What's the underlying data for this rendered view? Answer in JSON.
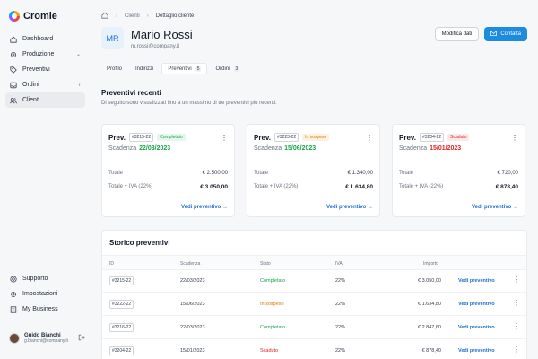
{
  "app": {
    "name": "Cromie"
  },
  "sidebar": {
    "items": [
      {
        "label": "Dashboard",
        "icon": "home-icon"
      },
      {
        "label": "Produzione",
        "icon": "gear-icon",
        "chevron": "⌄"
      },
      {
        "label": "Preventivi",
        "icon": "tag-icon"
      },
      {
        "label": "Ordini",
        "icon": "inbox-icon",
        "count": "7"
      },
      {
        "label": "Clienti",
        "icon": "users-icon",
        "active": true
      }
    ],
    "bottom": [
      {
        "label": "Supporto",
        "icon": "help-icon"
      },
      {
        "label": "Impostazioni",
        "icon": "settings-icon"
      },
      {
        "label": "My Business",
        "icon": "building-icon"
      }
    ],
    "user": {
      "name": "Guido Bianchi",
      "email": "g.bianchi@company.it"
    }
  },
  "breadcrumb": {
    "items": [
      "Clienti",
      "Dettaglio cliente"
    ]
  },
  "client": {
    "initials": "MR",
    "name": "Mario Rossi",
    "email": "m.rossi@company.it"
  },
  "header": {
    "edit_label": "Modifica dati",
    "contact_label": "Contatta"
  },
  "tabs": [
    {
      "label": "Profilo"
    },
    {
      "label": "Indirizzi"
    },
    {
      "label": "Preventivi",
      "count": "5",
      "active": true
    },
    {
      "label": "Ordini",
      "count": "3"
    }
  ],
  "recent": {
    "title": "Preventivi recenti",
    "subtitle": "Di seguito sono visualizzati fino a un massimo di tre preventivi più recenti.",
    "cards": [
      {
        "prefix": "Prev.",
        "code": "#3215-22",
        "status": "Completato",
        "due_label": "Scadenza",
        "due": "22/03/2023",
        "total_label": "Totale",
        "total": "€ 2.500,00",
        "total_iva_label": "Totale + IVA (22%)",
        "total_iva": "€ 3.050,00",
        "link": "Vedi preventivo →"
      },
      {
        "prefix": "Prev.",
        "code": "#3223-22",
        "status": "In sospeso",
        "due_label": "Scadenza",
        "due": "15/06/2023",
        "total_label": "Totale",
        "total": "€ 1.340,00",
        "total_iva_label": "Totale + IVA (22%)",
        "total_iva": "€ 1.634,80",
        "link": "Vedi preventivo →"
      },
      {
        "prefix": "Prev.",
        "code": "#3204-22",
        "status": "Scaduto",
        "due_label": "Scadenza",
        "due": "15/01/2023",
        "total_label": "Totale",
        "total": "€ 720,00",
        "total_iva_label": "Totale + IVA (22%)",
        "total_iva": "€ 878,40",
        "link": "Vedi preventivo →"
      }
    ]
  },
  "history": {
    "title": "Storico preventivi",
    "columns": [
      "ID",
      "Scadenza",
      "Stato",
      "IVA",
      "Importo"
    ],
    "rows": [
      {
        "id": "#3215-22",
        "due": "22/03/2023",
        "status": "Completato",
        "iva": "22%",
        "amount": "€ 3.050,00",
        "link": "Vedi preventivo"
      },
      {
        "id": "#3222-22",
        "due": "15/06/2023",
        "status": "In sospeso",
        "iva": "22%",
        "amount": "€ 1.634,80",
        "link": "Vedi preventivo"
      },
      {
        "id": "#3216-22",
        "due": "22/03/2023",
        "status": "Completato",
        "iva": "22%",
        "amount": "€ 2.847,60",
        "link": "Vedi preventivo"
      },
      {
        "id": "#3204-22",
        "due": "15/01/2023",
        "status": "Scaduto",
        "iva": "22%",
        "amount": "€ 878,40",
        "link": "Vedi preventivo"
      }
    ]
  },
  "colors": {
    "primary": "#1d8ce0",
    "link": "#1d6fd0",
    "green": "#16a34a",
    "orange": "#d97706",
    "red": "#dc2626"
  }
}
